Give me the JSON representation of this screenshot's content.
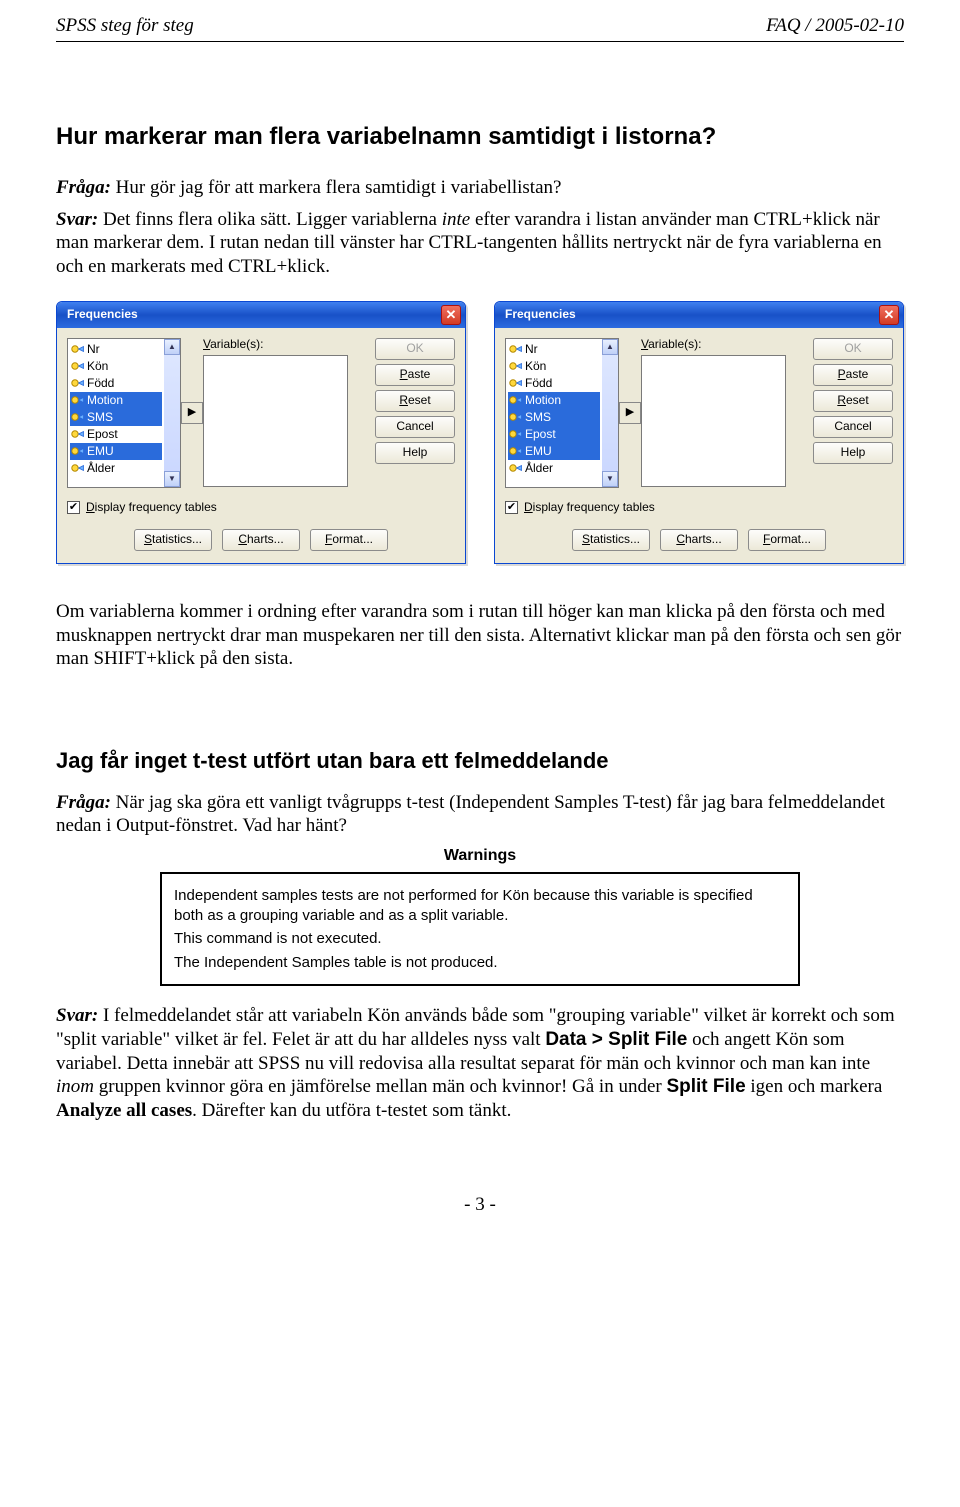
{
  "header": {
    "left": "SPSS steg för steg",
    "right": "FAQ / 2005-02-10"
  },
  "s1": {
    "title": "Hur markerar man flera variabelnamn samtidigt i listorna?",
    "q_label": "Fråga:",
    "q_text": " Hur gör jag för att markera flera samtidigt i variabellistan?",
    "a_label": "Svar:",
    "a_text_before_inte": " Det finns flera olika sätt. Ligger variablerna ",
    "a_inte": "inte",
    "a_text_after_inte": " efter varandra i listan använder man CTRL+klick när man markerar dem. I rutan nedan till vänster har CTRL-tangenten hållits nertryckt när de fyra variablerna en och en markerats med CTRL+klick."
  },
  "dialog": {
    "title": "Frequencies",
    "vlabel_pre": "V",
    "vlabel_rest": "ariable(s):",
    "buttons": {
      "ok": "OK",
      "paste": "Paste",
      "reset": "Reset",
      "cancel": "Cancel",
      "help": "Help"
    },
    "bottom": {
      "statistics": "Statistics...",
      "charts": "Charts...",
      "format": "Format..."
    },
    "checkbox_label_pre": "D",
    "checkbox_label_rest": "isplay frequency tables",
    "vars": [
      {
        "name": "Nr",
        "sel_l": false,
        "sel_r": false
      },
      {
        "name": "Kön",
        "sel_l": false,
        "sel_r": false
      },
      {
        "name": "Född",
        "sel_l": false,
        "sel_r": false
      },
      {
        "name": "Motion",
        "sel_l": true,
        "sel_r": true
      },
      {
        "name": "SMS",
        "sel_l": true,
        "sel_r": true
      },
      {
        "name": "Epost",
        "sel_l": false,
        "sel_r": true
      },
      {
        "name": "EMU",
        "sel_l": true,
        "sel_r": true
      },
      {
        "name": "Ålder",
        "sel_l": false,
        "sel_r": false
      }
    ]
  },
  "s1b": {
    "para": "Om variablerna kommer i ordning efter varandra som i rutan till höger kan man klicka på den första och med musknappen nertryckt drar man muspekaren ner till den sista. Alternativt klickar man på den första och sen gör man SHIFT+klick på den sista."
  },
  "s2": {
    "title": "Jag får inget t-test utfört utan bara ett felmeddelande",
    "q_label": "Fråga:",
    "q_text": " När jag ska göra ett vanligt tvågrupps t-test (Independent Samples T-test) får jag bara felmeddelandet nedan i Output-fönstret. Vad har hänt?",
    "warn_title": "Warnings",
    "w1": "Independent samples tests are not performed for Kön because this variable is specified both as a grouping variable and as a split variable.",
    "w2": "This command is not executed.",
    "w3": "The Independent Samples table is not produced.",
    "a_label": "Svar:",
    "a_p1a": " I felmeddelandet står att variabeln Kön används både som \"grouping variable\" vilket är korrekt och som \"split variable\" vilket är fel. Felet är att du har alldeles nyss valt ",
    "data_split": "Data > Split File",
    "a_p1b": " och angett Kön som variabel. Detta innebär att SPSS nu vill redovisa alla resultat separat för män och kvinnor och man kan inte ",
    "inom": "inom",
    "a_p1c": " gruppen kvinnor göra en jämförelse mellan män och kvinnor! Gå in under ",
    "split_file": "Split File",
    "a_p1d": " igen och markera ",
    "analyze_all": "Analyze all cases",
    "a_p1e": ". Därefter kan du utföra t-testet som tänkt."
  },
  "footer": {
    "pagenum": "- 3 -"
  }
}
